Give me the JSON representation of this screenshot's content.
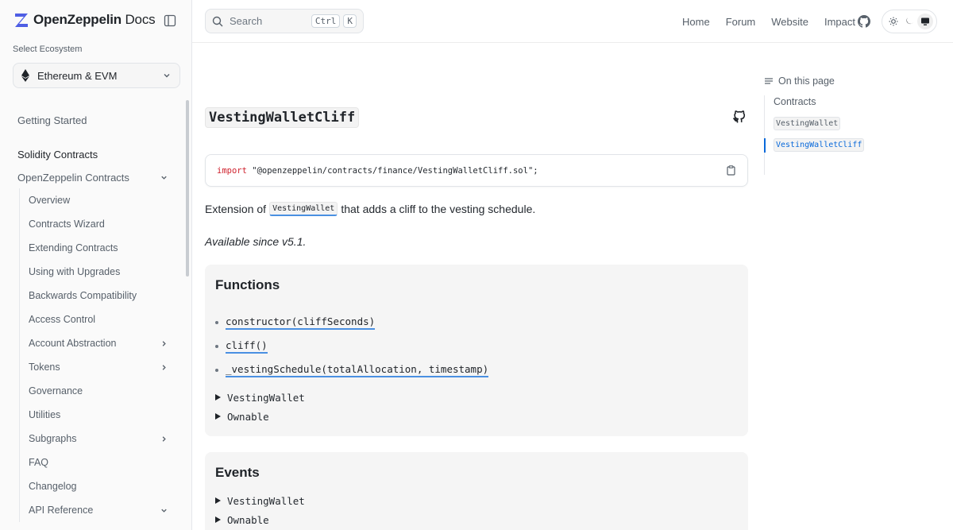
{
  "brand": {
    "name_bold": "OpenZeppelin",
    "name_light": "Docs"
  },
  "ecosystem": {
    "label": "Select Ecosystem",
    "value": "Ethereum & EVM"
  },
  "nav": {
    "getting_started": "Getting Started",
    "section": "Solidity Contracts",
    "group": "OpenZeppelin Contracts",
    "items": [
      {
        "label": "Overview",
        "chevron": false
      },
      {
        "label": "Contracts Wizard",
        "chevron": false
      },
      {
        "label": "Extending Contracts",
        "chevron": false
      },
      {
        "label": "Using with Upgrades",
        "chevron": false
      },
      {
        "label": "Backwards Compatibility",
        "chevron": false
      },
      {
        "label": "Access Control",
        "chevron": false
      },
      {
        "label": "Account Abstraction",
        "chevron": "right"
      },
      {
        "label": "Tokens",
        "chevron": "right"
      },
      {
        "label": "Governance",
        "chevron": false
      },
      {
        "label": "Utilities",
        "chevron": false
      },
      {
        "label": "Subgraphs",
        "chevron": "right"
      },
      {
        "label": "FAQ",
        "chevron": false
      },
      {
        "label": "Changelog",
        "chevron": false
      },
      {
        "label": "API Reference",
        "chevron": "down"
      }
    ]
  },
  "search": {
    "placeholder": "Search",
    "kbd1": "Ctrl",
    "kbd2": "K"
  },
  "topnav": {
    "home": "Home",
    "forum": "Forum",
    "website": "Website",
    "impact": "Impact"
  },
  "content": {
    "title": "VestingWalletCliff",
    "import_kw": "import",
    "import_path": " \"@openzeppelin/contracts/finance/VestingWalletCliff.sol\";",
    "desc_before": "Extension of",
    "desc_code": "VestingWallet",
    "desc_after": "that adds a cliff to the vesting schedule.",
    "since": "Available since v5.1.",
    "functions": {
      "heading": "Functions",
      "items": [
        "constructor(cliffSeconds)",
        "cliff()",
        "_vestingSchedule(totalAllocation, timestamp)"
      ],
      "details": [
        "VestingWallet",
        "Ownable"
      ]
    },
    "events": {
      "heading": "Events",
      "details": [
        "VestingWallet",
        "Ownable"
      ]
    }
  },
  "toc": {
    "heading": "On this page",
    "contracts": "Contracts",
    "item1": "VestingWallet",
    "item2": "VestingWalletCliff"
  },
  "colors": {
    "accent": "#0969da",
    "link_underline": "#4a90e2",
    "card_bg": "#f5f5f5"
  }
}
